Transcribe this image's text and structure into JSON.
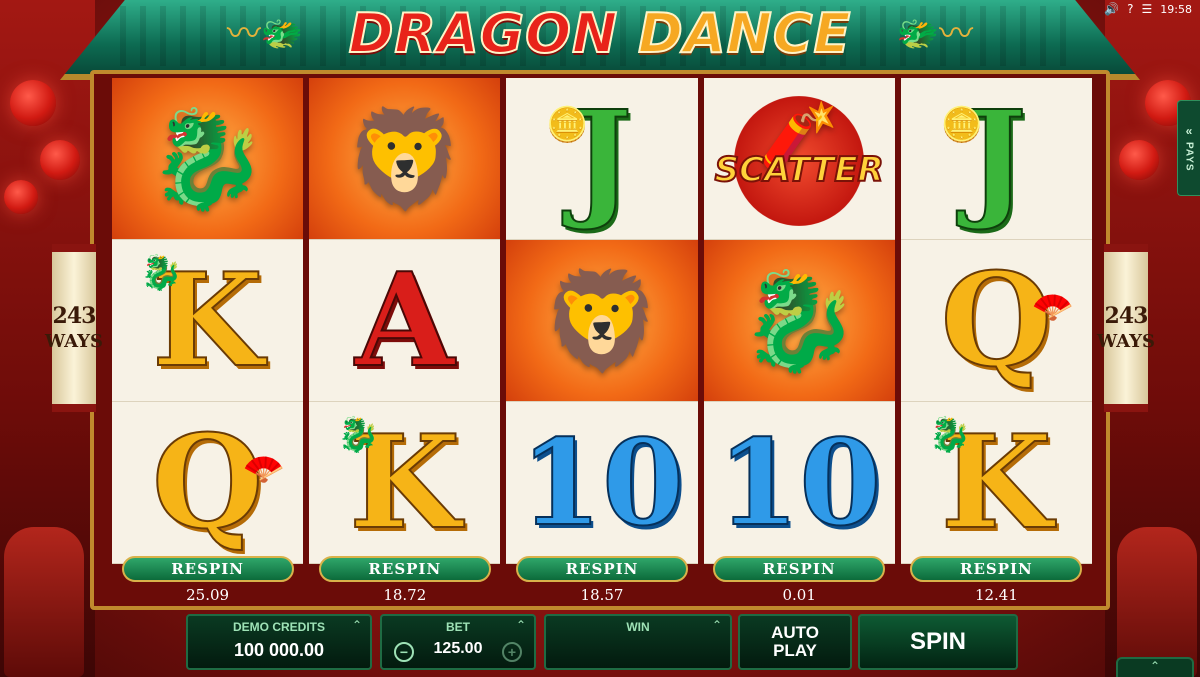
{
  "title": {
    "word1": "DRAGON",
    "word2": "DANCE"
  },
  "status": {
    "time": "19:58",
    "sound_icon": "speaker-icon",
    "help_icon": "question-icon",
    "menu_icon": "menu-icon"
  },
  "ways": {
    "count": "243",
    "word": "WAYS"
  },
  "pays_tab": {
    "label": "PAYS",
    "chevron": "«"
  },
  "reels": [
    {
      "symbols": [
        {
          "type": "dragon",
          "glyph": "🐉",
          "bg": "red"
        },
        {
          "type": "K",
          "glyph": "K",
          "style": "gold",
          "badge": "dragon-mini"
        },
        {
          "type": "Q",
          "glyph": "Q",
          "style": "gold",
          "badge": "fan"
        }
      ],
      "respin_label": "RESPIN",
      "respin_cost": "25.09"
    },
    {
      "symbols": [
        {
          "type": "lion",
          "glyph": "🦁",
          "bg": "red"
        },
        {
          "type": "A",
          "glyph": "A",
          "style": "red"
        },
        {
          "type": "K",
          "glyph": "K",
          "style": "gold",
          "badge": "dragon-mini"
        }
      ],
      "respin_label": "RESPIN",
      "respin_cost": "18.72"
    },
    {
      "symbols": [
        {
          "type": "J",
          "glyph": "J",
          "style": "green",
          "badge": "coin"
        },
        {
          "type": "lion",
          "glyph": "🦁",
          "bg": "red"
        },
        {
          "type": "10",
          "glyph": "10",
          "style": "blue"
        }
      ],
      "respin_label": "RESPIN",
      "respin_cost": "18.57"
    },
    {
      "symbols": [
        {
          "type": "scatter",
          "glyph": "🧨",
          "label": "SCATTER"
        },
        {
          "type": "dragon",
          "glyph": "🐉",
          "bg": "red"
        },
        {
          "type": "10",
          "glyph": "10",
          "style": "blue"
        }
      ],
      "respin_label": "RESPIN",
      "respin_cost": "0.01"
    },
    {
      "symbols": [
        {
          "type": "J",
          "glyph": "J",
          "style": "green",
          "badge": "coin"
        },
        {
          "type": "Q",
          "glyph": "Q",
          "style": "gold",
          "badge": "fan"
        },
        {
          "type": "K",
          "glyph": "K",
          "style": "gold",
          "badge": "dragon-mini"
        }
      ],
      "respin_label": "RESPIN",
      "respin_cost": "12.41"
    }
  ],
  "panel": {
    "credits_label": "DEMO CREDITS",
    "credits_value": "100 000.00",
    "bet_label": "BET",
    "bet_value": "125.00",
    "bet_minus": "−",
    "bet_plus": "+",
    "win_label": "WIN",
    "win_value": "",
    "autoplay_line1": "AUTO",
    "autoplay_line2": "PLAY",
    "spin_label": "SPIN",
    "caret": "⌃"
  },
  "colors": {
    "accent_green": "#0c6b3b",
    "gold": "#f6b417",
    "title_red": "#e8231a",
    "title_orange": "#f6a822"
  }
}
